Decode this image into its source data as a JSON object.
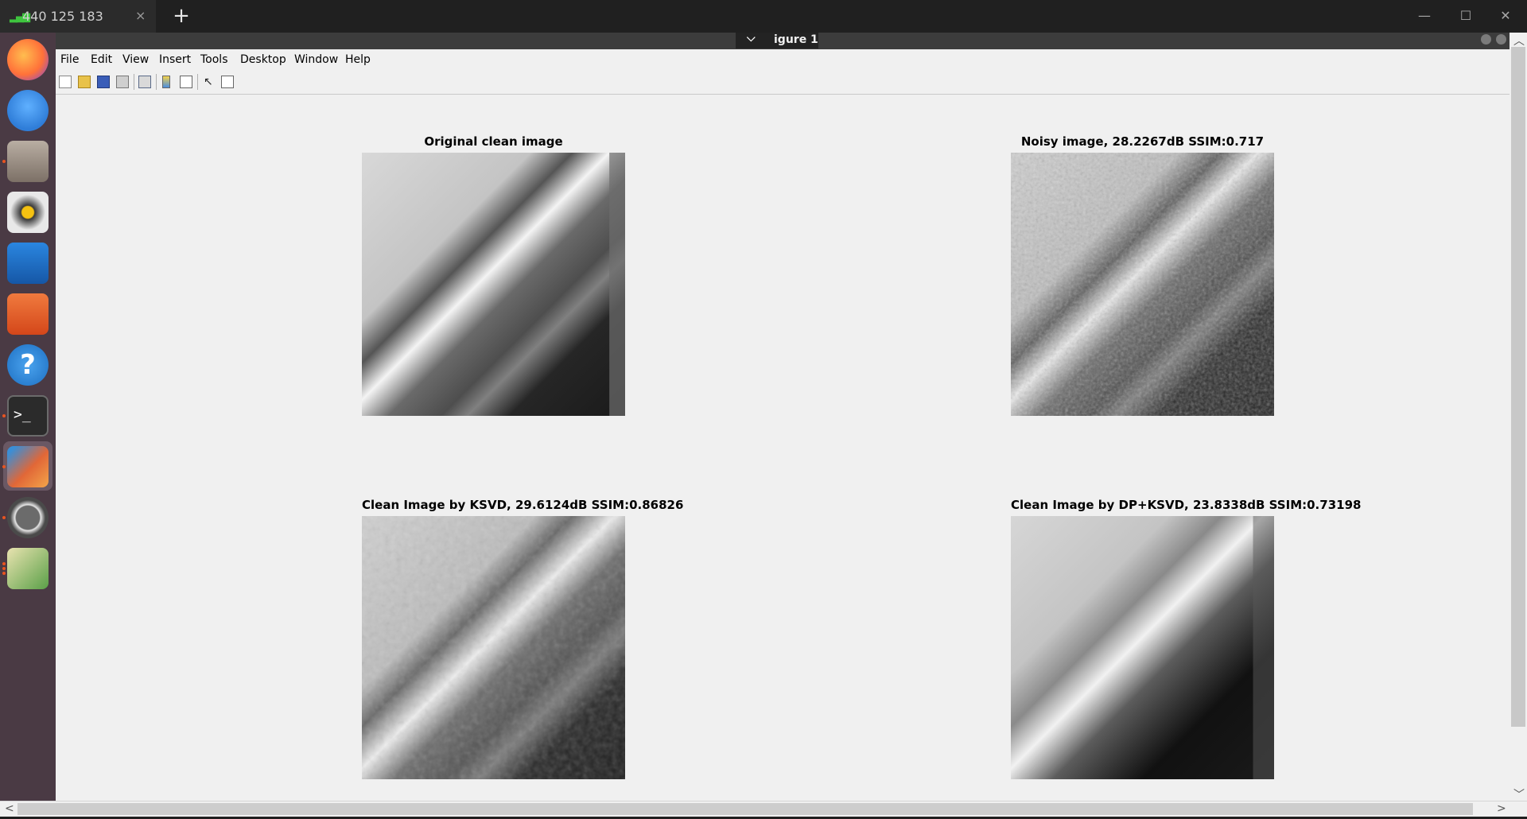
{
  "remote_tab": {
    "label": "440 125 183",
    "close": "×",
    "new_tab": "+"
  },
  "window_controls": {
    "minimize": "—",
    "maximize": "☐",
    "close": "✕"
  },
  "launcher": {
    "apps": [
      {
        "name": "firefox-icon",
        "color": "#ff7139"
      },
      {
        "name": "thunderbird-icon",
        "color": "#2f7dd8"
      },
      {
        "name": "files-icon",
        "color": "#9a8e84"
      },
      {
        "name": "rhythmbox-icon",
        "color": "#f5c211"
      },
      {
        "name": "writer-icon",
        "color": "#1e6fc6"
      },
      {
        "name": "software-center-icon",
        "color": "#e95420"
      },
      {
        "name": "help-icon",
        "color": "#2f86d6"
      },
      {
        "name": "terminal-icon",
        "color": "#2e2e2e"
      },
      {
        "name": "matlab-icon",
        "color": "#e16737"
      },
      {
        "name": "software-updater-icon",
        "color": "#4a4a4a"
      },
      {
        "name": "image-viewer-icon",
        "color": "#5aa048"
      }
    ]
  },
  "figure": {
    "title_prefix": "igure 1",
    "menu": [
      "File",
      "Edit",
      "View",
      "Insert",
      "Tools",
      "Desktop",
      "Window",
      "Help"
    ],
    "toolbar": [
      "new-figure-icon",
      "open-icon",
      "save-icon",
      "print-icon",
      "print-preview-icon",
      "colorbar-icon",
      "legend-icon",
      "select-arrow-icon",
      "property-editor-icon"
    ],
    "panels": [
      {
        "title": "Original clean image",
        "kind": "clean"
      },
      {
        "title": "Noisy image, 28.2267dB SSIM:0.717",
        "kind": "noisy"
      },
      {
        "title": "Clean Image by KSVD, 29.6124dB SSIM:0.86826",
        "kind": "ksvd"
      },
      {
        "title": "Clean Image by DP+KSVD, 23.8338dB SSIM:0.73198",
        "kind": "dpksvd"
      }
    ]
  },
  "scrollbars": {
    "left": "<",
    "right": ">",
    "up": "^",
    "down": "v"
  }
}
